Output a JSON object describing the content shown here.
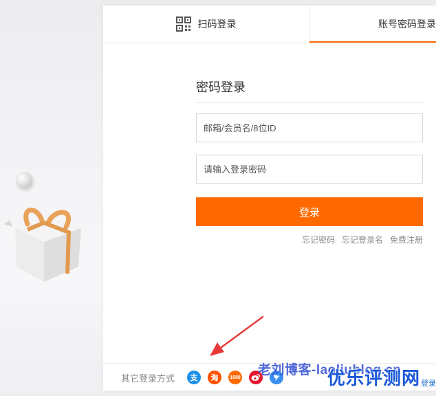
{
  "tabs": {
    "qr_label": "扫码登录",
    "account_label": "账号密码登录"
  },
  "form": {
    "title": "密码登录",
    "username_placeholder": "邮箱/会员名/8位ID",
    "password_placeholder": "请输入登录密码",
    "login_button": "登录"
  },
  "links": {
    "forgot_password": "忘记密码",
    "forgot_username": "忘记登录名",
    "register": "免费注册"
  },
  "other_login": {
    "label": "其它登录方式",
    "icons": [
      "alipay-icon",
      "taobao-icon",
      "1688-icon",
      "weibo-icon",
      "dingtalk-icon"
    ],
    "alipay_glyph": "支",
    "taobao_glyph": "淘",
    "icon_1688_glyph": "1688",
    "register_cut": "登录"
  },
  "watermarks": {
    "blog": "老刘博客-laoliublog.cn",
    "site": "优乐评测网"
  },
  "colors": {
    "accent": "#ff6a00",
    "arrow": "#e8393a",
    "watermark": "#1b58d8"
  }
}
